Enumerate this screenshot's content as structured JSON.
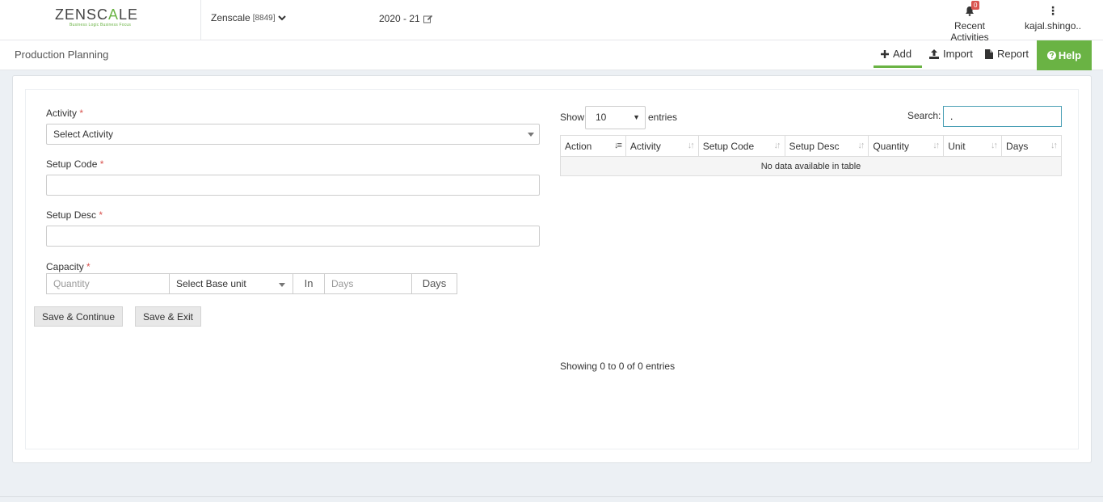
{
  "brand": {
    "logo_a": "ZENSC",
    "logo_b": "A",
    "logo_c": "LE",
    "tagline": "Business Logic Business Focus",
    "accent": "#6ab344"
  },
  "header": {
    "company": "Zenscale",
    "company_code": "[8849]",
    "fiscal_year": "2020 - 21",
    "recent_label": "Recent Activities",
    "notif_count": "0",
    "user_menu_dots": "⋮",
    "user": "kajal.shingo.."
  },
  "subheader": {
    "title": "Production Planning",
    "add": "Add",
    "import": "Import",
    "report": "Report",
    "help": "Help"
  },
  "form": {
    "activity_label": "Activity",
    "activity_value": "Select Activity",
    "setup_code_label": "Setup Code",
    "setup_desc_label": "Setup Desc",
    "capacity_label": "Capacity",
    "required_mark": "*",
    "quantity_placeholder": "Quantity",
    "base_unit_value": "Select Base unit",
    "in_label": "In",
    "days_placeholder": "Days",
    "days_addon": "Days",
    "save_continue": "Save & Continue",
    "save_exit": "Save & Exit"
  },
  "table": {
    "show_label": "Show",
    "page_length": "10",
    "entries_label": "entries",
    "search_label": "Search:",
    "search_value": ".",
    "columns": [
      "Action",
      "Activity",
      "Setup Code",
      "Setup Desc",
      "Quantity",
      "Unit",
      "Days"
    ],
    "empty_message": "No data available in table",
    "info": "Showing 0 to 0 of 0 entries"
  }
}
